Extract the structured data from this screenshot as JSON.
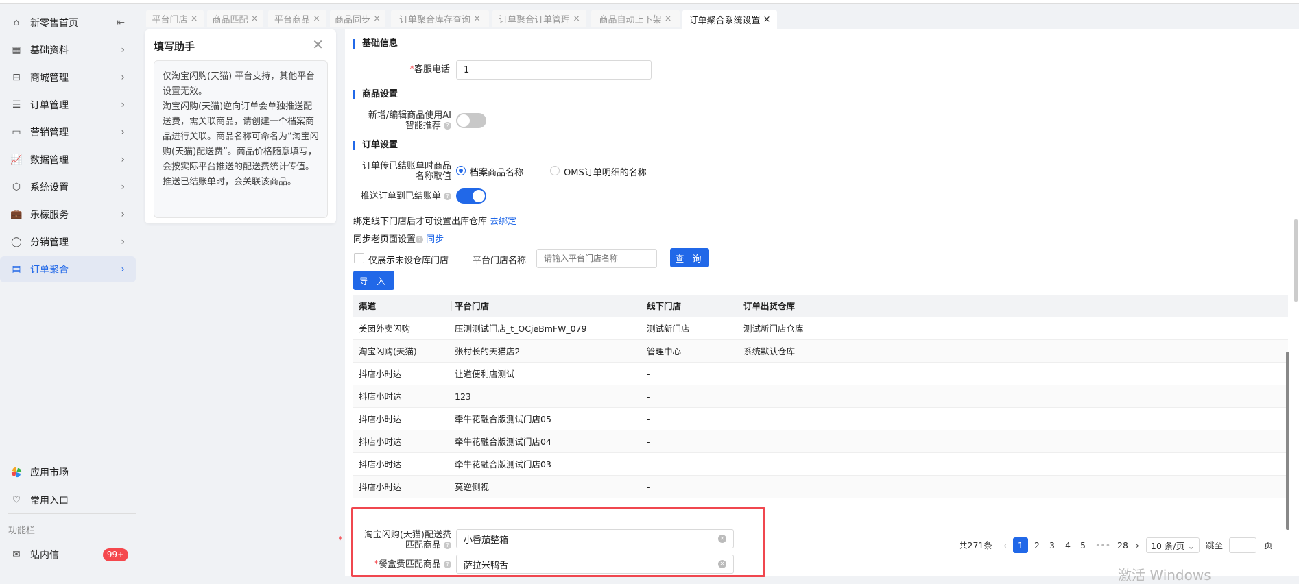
{
  "sidebar": {
    "home": "新零售首页",
    "items": [
      {
        "label": "基础资料"
      },
      {
        "label": "商城管理"
      },
      {
        "label": "订单管理"
      },
      {
        "label": "营销管理"
      },
      {
        "label": "数据管理"
      },
      {
        "label": "系统设置"
      },
      {
        "label": "乐檬服务"
      },
      {
        "label": "分销管理"
      },
      {
        "label": "订单聚合"
      }
    ],
    "app_market": "应用市场",
    "favorites": "常用入口",
    "function_bar": "功能栏",
    "inbox": "站内信",
    "inbox_badge": "99+"
  },
  "tabs": [
    {
      "label": "平台门店"
    },
    {
      "label": "商品匹配"
    },
    {
      "label": "平台商品"
    },
    {
      "label": "商品同步"
    },
    {
      "label": "订单聚合库存查询"
    },
    {
      "label": "订单聚合订单管理"
    },
    {
      "label": "商品自动上下架"
    },
    {
      "label": "订单聚合系统设置"
    }
  ],
  "helper": {
    "title": "填写助手",
    "text": "仅淘宝闪购(天猫) 平台支持，其他平台设置无效。\n淘宝闪购(天猫)逆向订单会单独推送配送费，需关联商品，请创建一个档案商品进行关联。商品名称可命名为“淘宝闪购(天猫)配送费”。商品价格随意填写，会按实际平台推送的配送费统计传值。推送已结账单时，会关联该商品。"
  },
  "form": {
    "basic_title": "基础信息",
    "phone_label": "客服电话",
    "phone_value": "1",
    "goods_title": "商品设置",
    "ai_label_1": "新增/编辑商品使用AI",
    "ai_label_2": "智能推荐",
    "ai_on": false,
    "order_title": "订单设置",
    "name_label_1": "订单传已结账单时商品",
    "name_label_2": "名称取值",
    "radio_1": "档案商品名称",
    "radio_2": "OMS订单明细的名称",
    "push_label": "推送订单到已结账单",
    "push_on": true,
    "bind_text": "绑定线下门店后才可设置出库仓库",
    "bind_link": "去绑定",
    "sync_text": "同步老页面设置",
    "sync_link": "同步",
    "only_unset": "仅展示未设仓库门店",
    "store_name_label": "平台门店名称",
    "store_name_placeholder": "请输入平台门店名称",
    "query": "查 询",
    "import": "导 入",
    "delivery_label_1": "淘宝闪购(天猫)配送费",
    "delivery_label_2": "匹配商品",
    "delivery_value": "小番茄整箱",
    "box_label": "餐盒费匹配商品",
    "box_value": "萨拉米鸭舌"
  },
  "table": {
    "headers": [
      "渠道",
      "平台门店",
      "线下门店",
      "订单出货仓库"
    ],
    "rows": [
      [
        "美团外卖闪购",
        "压测测试门店_t_OCjeBmFW_079",
        "测试新门店",
        "测试新门店仓库"
      ],
      [
        "淘宝闪购(天猫)",
        "张村长的天猫店2",
        "管理中心",
        "系统默认仓库"
      ],
      [
        "抖店小时达",
        "让道便利店测试",
        "-",
        ""
      ],
      [
        "抖店小时达",
        "123",
        "-",
        ""
      ],
      [
        "抖店小时达",
        "牵牛花融合版测试门店05",
        "-",
        ""
      ],
      [
        "抖店小时达",
        "牵牛花融合版测试门店04",
        "-",
        ""
      ],
      [
        "抖店小时达",
        "牵牛花融合版测试门店03",
        "-",
        ""
      ],
      [
        "抖店小时达",
        "莫逆侧视",
        "-",
        ""
      ]
    ]
  },
  "pagination": {
    "total": "共271条",
    "pages": [
      "1",
      "2",
      "3",
      "4",
      "5",
      "•••",
      "28"
    ],
    "page_size": "10 条/页",
    "jump": "跳至",
    "page_unit": "页"
  },
  "watermark": "激活 Windows",
  "colors": {
    "primary": "#2168e8",
    "badge": "#f5484d",
    "highlight": "#f0474f"
  }
}
